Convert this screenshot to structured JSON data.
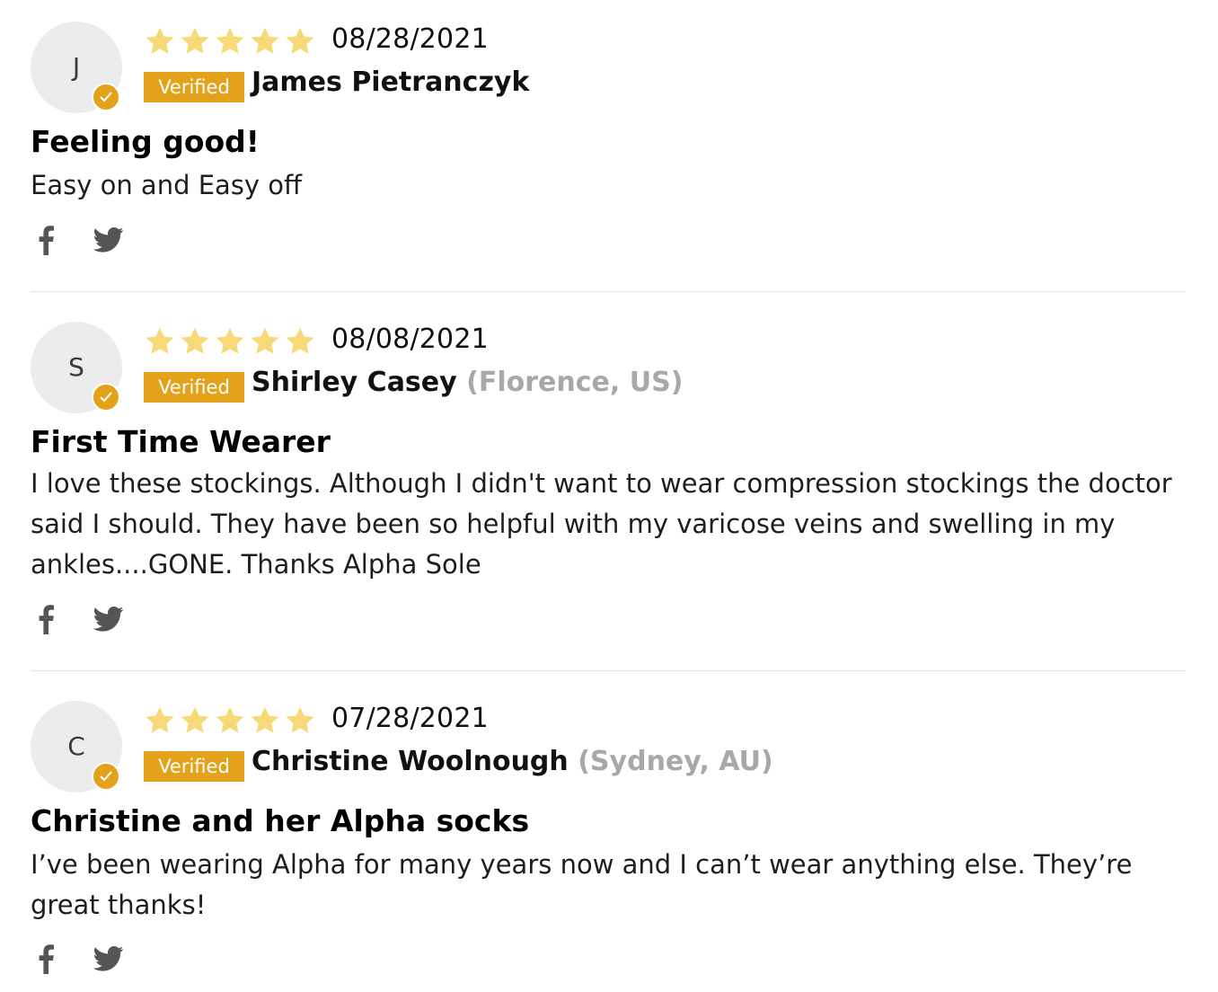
{
  "reviews": [
    {
      "avatar_letter": "J",
      "rating": 5,
      "date": "08/28/2021",
      "verified_label": "Verified",
      "author": "James Pietranczyk",
      "location": "",
      "title": "Feeling good!",
      "body": "Easy on and Easy off"
    },
    {
      "avatar_letter": "S",
      "rating": 5,
      "date": "08/08/2021",
      "verified_label": "Verified",
      "author": "Shirley Casey",
      "location": "(Florence, US)",
      "title": "First Time Wearer",
      "body": "I love these stockings. Although I didn't want to wear compression stockings the doctor said I should. They have been so helpful with my varicose veins and swelling in my ankles....GONE. Thanks Alpha Sole"
    },
    {
      "avatar_letter": "C",
      "rating": 5,
      "date": "07/28/2021",
      "verified_label": "Verified",
      "author": "Christine Woolnough",
      "location": "(Sydney, AU)",
      "title": "Christine and her Alpha socks",
      "body": "I’ve been wearing Alpha for many years now and I can’t wear anything else. They’re great thanks!"
    }
  ],
  "icons": {
    "star": "star-icon",
    "verified_check": "check-icon",
    "share_facebook": "facebook-icon",
    "share_twitter": "twitter-icon"
  },
  "colors": {
    "star": "#f7d978",
    "verified_badge": "#e3a21a",
    "location": "#a8a8a8",
    "social_icon": "#555555"
  }
}
